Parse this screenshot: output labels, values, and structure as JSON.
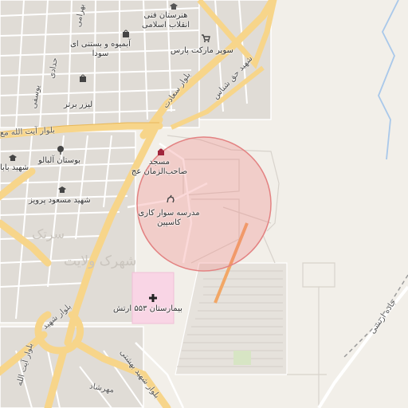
{
  "map": {
    "radius_circle_color": "#f08080",
    "area_labels": {
      "sartak": "سرتک",
      "velayat": "شهرک ولایت"
    },
    "poi": {
      "school_top": "هنرستان فنی انقلاب اسلامی",
      "supermarket": "سوپر مارکت پارس",
      "fruit_shop": "آبمیوه و بستنی ای سودا",
      "laser": "لیزر برتر",
      "park": "بوستان آلبالو",
      "school_baba": "شهید بابا",
      "school_masoud": "شهید مسعود پرویز",
      "mosque": "مسجد صاحب‌الزمان عج",
      "driving_school": "مدرسه سوار کاری کاسپین",
      "hospital": "بیمارستان ۵۵۳ ارتش"
    },
    "roads": {
      "ayatollah_blvd": "بلوار آیت الله مع",
      "saadat_blvd": "بلوار سعادت",
      "haghshenas": "شهید حق شناس",
      "yousefi": "یوسفی",
      "bahrami": "بهرامی",
      "haddadi": "حدادی",
      "shahid_beheshti": "بلوار شهید بهشتی",
      "shahid_left": "بلوار شهید",
      "ayatollah_left": "بلوار آیت الله",
      "jadeh_arteshi": "جاده ارتشی",
      "mehrshad": "مهرشاد"
    },
    "icons": {
      "school": "school-icon",
      "shop": "shopping-cart-icon",
      "fruit": "shop-bag-icon",
      "park": "tree-icon",
      "mosque": "mosque-icon",
      "horse": "horse-icon",
      "hospital": "hospital-cross-icon"
    }
  }
}
